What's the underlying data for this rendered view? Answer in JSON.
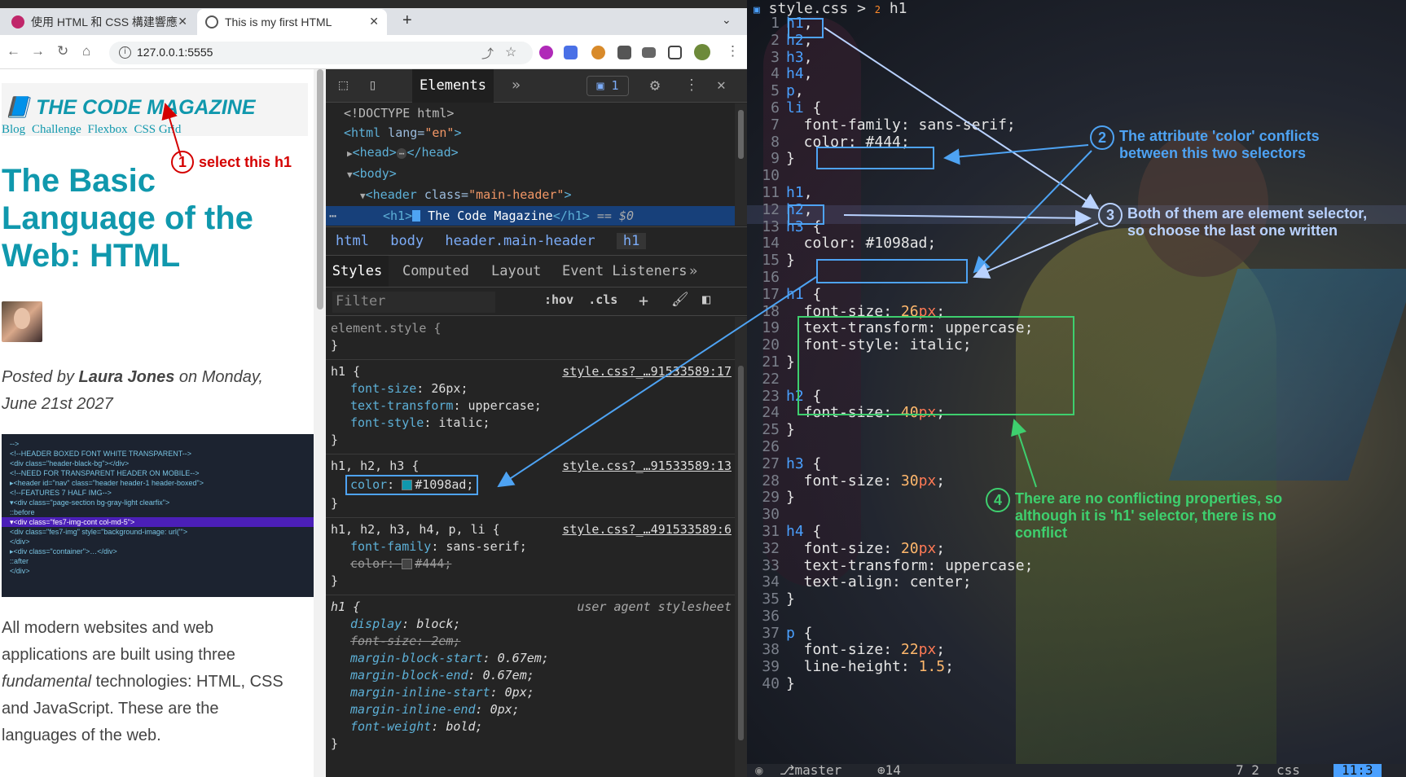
{
  "browser": {
    "tabs": [
      {
        "title": "使用 HTML 和 CSS 構建響應",
        "active": false
      },
      {
        "title": "This is my first HTML",
        "active": true
      }
    ],
    "url": "127.0.0.1:5555"
  },
  "webpage": {
    "logo": "📘 THE CODE MAGAZINE",
    "nav": [
      "Blog",
      "Challenge",
      "Flexbox",
      "CSS Grid"
    ],
    "title": "The Basic Language of the Web: HTML",
    "posted_prefix": "Posted by",
    "author": "Laura Jones",
    "posted_suffix": "on Monday, June 21st 2027",
    "image_code": [
      "-->",
      "<!--HEADER BOXED FONT WHITE TRANSPARENT-->",
      "<div class=\"header-black-bg\"></div>",
      "<!--NEED FOR TRANSPARENT HEADER ON MOBILE-->",
      "▸<header id=\"nav\" class=\"header header-1 header-boxed\">",
      "<!--FEATURES 7 HALF IMG-->",
      "▾<div class=\"page-section bg-gray-light clearfix\">",
      "::before",
      "▾<div class=\"fes7-img-cont col-md-5\">",
      "<div class=\"fes7-img\" style=\"background-image: url('\">",
      "</div>",
      "▸<div class=\"container\">…</div>",
      "::after",
      "</div>"
    ],
    "p_before": "All modern websites and web applications are built using three",
    "p_em": "fundamental",
    "p_after": "technologies: HTML, CSS and JavaScript. These are the languages of the web."
  },
  "annotations": {
    "a1_num": "1",
    "a1_text": "select this h1",
    "a2_num": "2",
    "a2_text": "The attribute 'color' conflicts between this two selectors",
    "a3_num": "3",
    "a3_text": "Both of them are element selector, so choose the last one written",
    "a4_num": "4",
    "a4_text": "There are no conflicting properties, so although it is 'h1' selector, there is no conflict"
  },
  "devtools": {
    "tab": "Elements",
    "issues": "1",
    "dom": {
      "doctype": "<!DOCTYPE html>",
      "html_open": "<html",
      "lang_attr": " lang=",
      "lang_val": "\"en\"",
      "html_close": ">",
      "head": "<head>",
      "head_ell": "⋯",
      "head_close": "</head>",
      "body": "<body>",
      "header_open": "<header",
      "header_attr": " class=",
      "header_val": "\"main-header\"",
      "header_close": ">",
      "h1_open": "<h1>",
      "h1_text": " The Code Magazine",
      "h1_close": "</h1>",
      "h1_eq": " == $0"
    },
    "breadcrumbs": [
      "html",
      "body",
      "header.main-header",
      "h1"
    ],
    "subtabs": [
      "Styles",
      "Computed",
      "Layout",
      "Event Listeners"
    ],
    "filter_placeholder": "Filter",
    "hov": ":hov",
    "cls": ".cls",
    "rules": [
      {
        "selector": "element.style {",
        "source": "",
        "decls": []
      },
      {
        "selector": "h1 {",
        "source": "style.css?_…91533589:17",
        "decls": [
          {
            "p": "font-size",
            "v": "26px;"
          },
          {
            "p": "text-transform",
            "v": "uppercase;"
          },
          {
            "p": "font-style",
            "v": "italic;"
          }
        ]
      },
      {
        "selector": "h1, h2, h3 {",
        "source": "style.css?_…91533589:13",
        "decls": [
          {
            "p": "color",
            "v": "#1098ad;"
          }
        ]
      },
      {
        "selector": "h1, h2, h3, h4, p, li {",
        "source": "style.css?_…491533589:6",
        "decls": [
          {
            "p": "font-family",
            "v": "sans-serif;"
          },
          {
            "p": "color",
            "v": "#444;"
          }
        ]
      },
      {
        "selector": "h1 {",
        "source": "user agent stylesheet",
        "decls": [
          {
            "p": "display",
            "v": "block;"
          },
          {
            "p": "font-size",
            "v": "2em;"
          },
          {
            "p": "margin-block-start",
            "v": "0.67em;"
          },
          {
            "p": "margin-block-end",
            "v": "0.67em;"
          },
          {
            "p": "margin-inline-start",
            "v": "0px;"
          },
          {
            "p": "margin-inline-end",
            "v": "0px;"
          },
          {
            "p": "font-weight",
            "v": "bold;"
          }
        ]
      }
    ],
    "close_brace": "}"
  },
  "editor": {
    "path_file": "style.css",
    "path_sep": ">",
    "path_num": "2",
    "path_sym": "h1",
    "lines": [
      {
        "n": "1",
        "parts": [
          [
            "k",
            "h1"
          ],
          [
            "d",
            ","
          ]
        ]
      },
      {
        "n": "2",
        "parts": [
          [
            "k",
            "h2"
          ],
          [
            "d",
            ","
          ]
        ]
      },
      {
        "n": "3",
        "parts": [
          [
            "k",
            "h3"
          ],
          [
            "d",
            ","
          ]
        ]
      },
      {
        "n": "4",
        "parts": [
          [
            "k",
            "h4"
          ],
          [
            "d",
            ","
          ]
        ]
      },
      {
        "n": "5",
        "parts": [
          [
            "k",
            "p"
          ],
          [
            "d",
            ","
          ]
        ]
      },
      {
        "n": "6",
        "parts": [
          [
            "k",
            "li"
          ],
          [
            "d",
            " {"
          ]
        ]
      },
      {
        "n": "7",
        "parts": [
          [
            "d",
            "  font-family: sans-serif;"
          ]
        ]
      },
      {
        "n": "8",
        "parts": [
          [
            "d",
            "  color: #444;"
          ]
        ]
      },
      {
        "n": "9",
        "parts": [
          [
            "d",
            "}"
          ]
        ]
      },
      {
        "n": "10",
        "parts": []
      },
      {
        "n": "11",
        "parts": [
          [
            "k",
            "h1"
          ],
          [
            "d",
            ","
          ]
        ]
      },
      {
        "n": "12",
        "parts": [
          [
            "k",
            "h2"
          ],
          [
            "d",
            ","
          ]
        ]
      },
      {
        "n": "13",
        "parts": [
          [
            "k",
            "h3"
          ],
          [
            "d",
            " {"
          ]
        ]
      },
      {
        "n": "14",
        "parts": [
          [
            "d",
            "  color: #1098ad;"
          ]
        ]
      },
      {
        "n": "15",
        "parts": [
          [
            "d",
            "}"
          ]
        ]
      },
      {
        "n": "16",
        "parts": []
      },
      {
        "n": "17",
        "parts": [
          [
            "k",
            "h1"
          ],
          [
            "d",
            " {"
          ]
        ]
      },
      {
        "n": "18",
        "parts": [
          [
            "d",
            "  font-size: "
          ],
          [
            "n",
            "26"
          ],
          [
            "x",
            "px"
          ],
          [
            "d",
            ";"
          ]
        ]
      },
      {
        "n": "19",
        "parts": [
          [
            "d",
            "  text-transform: uppercase;"
          ]
        ]
      },
      {
        "n": "20",
        "parts": [
          [
            "d",
            "  font-style: italic;"
          ]
        ]
      },
      {
        "n": "21",
        "parts": [
          [
            "d",
            "}"
          ]
        ]
      },
      {
        "n": "22",
        "parts": []
      },
      {
        "n": "23",
        "parts": [
          [
            "k",
            "h2"
          ],
          [
            "d",
            " {"
          ]
        ]
      },
      {
        "n": "24",
        "parts": [
          [
            "d",
            "  font-size: "
          ],
          [
            "n",
            "40"
          ],
          [
            "x",
            "px"
          ],
          [
            "d",
            ";"
          ]
        ]
      },
      {
        "n": "25",
        "parts": [
          [
            "d",
            "}"
          ]
        ]
      },
      {
        "n": "26",
        "parts": []
      },
      {
        "n": "27",
        "parts": [
          [
            "k",
            "h3"
          ],
          [
            "d",
            " {"
          ]
        ]
      },
      {
        "n": "28",
        "parts": [
          [
            "d",
            "  font-size: "
          ],
          [
            "n",
            "30"
          ],
          [
            "x",
            "px"
          ],
          [
            "d",
            ";"
          ]
        ]
      },
      {
        "n": "29",
        "parts": [
          [
            "d",
            "}"
          ]
        ]
      },
      {
        "n": "30",
        "parts": []
      },
      {
        "n": "31",
        "parts": [
          [
            "k",
            "h4"
          ],
          [
            "d",
            " {"
          ]
        ]
      },
      {
        "n": "32",
        "parts": [
          [
            "d",
            "  font-size: "
          ],
          [
            "n",
            "20"
          ],
          [
            "x",
            "px"
          ],
          [
            "d",
            ";"
          ]
        ]
      },
      {
        "n": "33",
        "parts": [
          [
            "d",
            "  text-transform: uppercase;"
          ]
        ]
      },
      {
        "n": "34",
        "parts": [
          [
            "d",
            "  text-align: center;"
          ]
        ]
      },
      {
        "n": "35",
        "parts": [
          [
            "d",
            "}"
          ]
        ]
      },
      {
        "n": "36",
        "parts": []
      },
      {
        "n": "37",
        "parts": [
          [
            "k",
            "p"
          ],
          [
            "d",
            " {"
          ]
        ]
      },
      {
        "n": "38",
        "parts": [
          [
            "d",
            "  font-size: "
          ],
          [
            "n",
            "22"
          ],
          [
            "x",
            "px"
          ],
          [
            "d",
            ";"
          ]
        ]
      },
      {
        "n": "39",
        "parts": [
          [
            "d",
            "  line-height: "
          ],
          [
            "n",
            "1.5"
          ],
          [
            "d",
            ";"
          ]
        ]
      },
      {
        "n": "40",
        "parts": [
          [
            "d",
            "}"
          ]
        ]
      }
    ],
    "status": {
      "branch": "master",
      "count": "14",
      "diag": "7 2",
      "lang": "css",
      "pos": "11:3"
    }
  },
  "colors": {
    "accent": "#1098ad",
    "annotation_blue": "#4ea3f3",
    "annotation_green": "#3ecf6e",
    "annotation_red": "#d40000"
  }
}
